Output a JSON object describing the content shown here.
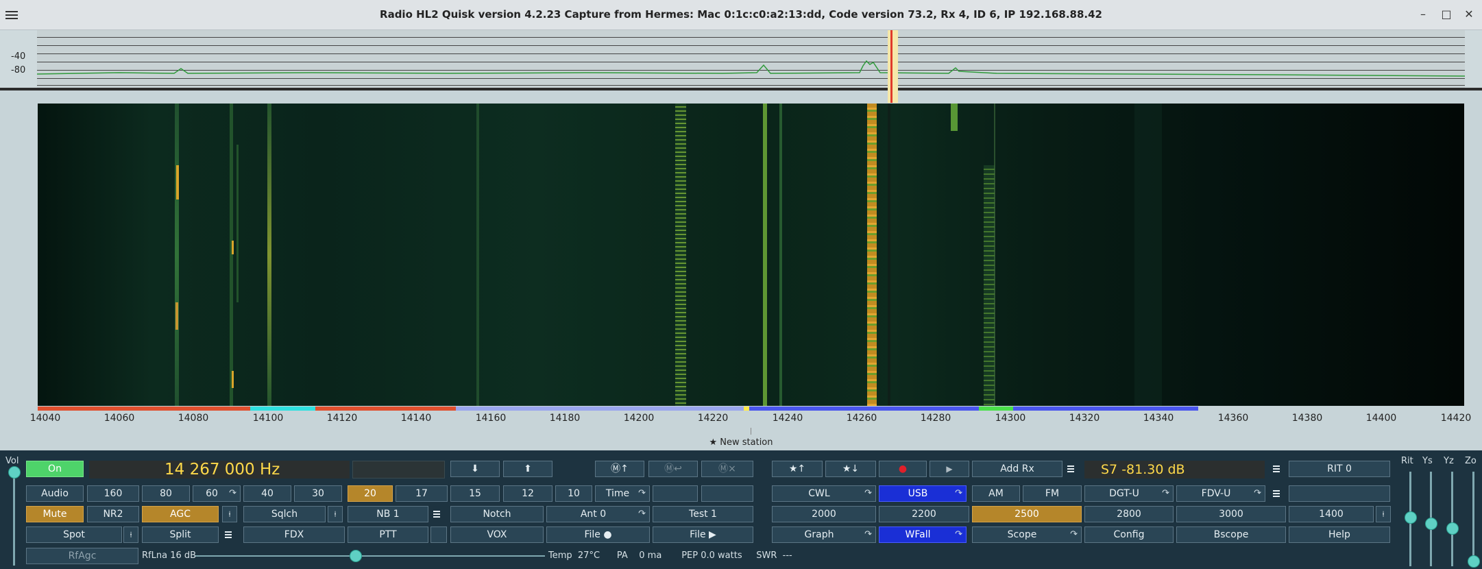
{
  "window": {
    "title": "Radio HL2   Quisk version 4.2.23   Capture from Hermes: Mac  0:1c:c0:a2:13:dd, Code version 73.2, Rx 4, ID 6, IP 192.168.88.42",
    "minimize": "–",
    "maximize": "□",
    "close": "✕"
  },
  "spectrum": {
    "label_top": "-40",
    "label_bottom": "-80"
  },
  "frequency_axis": [
    "14040",
    "14060",
    "14080",
    "14100",
    "14120",
    "14140",
    "14160",
    "14180",
    "14200",
    "14220",
    "14240",
    "14260",
    "14280",
    "14300",
    "14320",
    "14340",
    "14360",
    "14380",
    "14400",
    "14420"
  ],
  "new_station": "★ New station",
  "controls": {
    "vol": "Vol",
    "on": "On",
    "frequency": "14 267 000 Hz",
    "arrow_down": "⬇",
    "arrow_up": "⬆",
    "mem_up": "Ⓜ↑",
    "mem_return": "Ⓜ↩",
    "mem_delete": "Ⓜ×",
    "star_up": "★↑",
    "star_down": "★↓",
    "record": "●",
    "play": "▶",
    "add_rx": "Add Rx",
    "smeter": "S7    -81.30  dB",
    "rit0": "RIT 0",
    "rit": "Rit",
    "ys": "Ys",
    "yz": "Yz",
    "zo": "Zo",
    "row2": [
      "Audio",
      "160",
      "80",
      "60",
      "40",
      "30",
      "20",
      "17",
      "15",
      "12",
      "10",
      "Time"
    ],
    "row3_left": [
      "Mute",
      "NR2",
      "AGC",
      "Sqlch",
      "NB 1",
      "Notch",
      "Ant 0",
      "Test 1"
    ],
    "row4_left": [
      "Spot",
      "Split",
      "FDX",
      "PTT",
      "VOX",
      "File ●",
      "File ▶"
    ],
    "modes": [
      "CWL",
      "USB",
      "AM",
      "FM",
      "DGT-U",
      "FDV-U"
    ],
    "filters": [
      "2000",
      "2200",
      "2500",
      "2800",
      "3000",
      "1400"
    ],
    "row4_right": [
      "Graph",
      "WFall",
      "Scope",
      "Config",
      "Bscope",
      "Help"
    ],
    "rfagc": "RfAgc",
    "rflna": "RfLna 16 dB",
    "status": "Temp  27°C      PA    0 ma       PEP 0.0 watts     SWR  ---"
  },
  "colors": {
    "accent_on": "#b5862a",
    "selected_blue": "#1a2fd6",
    "on_green": "#4ed36a",
    "freq_yellow": "#ffd94a"
  }
}
